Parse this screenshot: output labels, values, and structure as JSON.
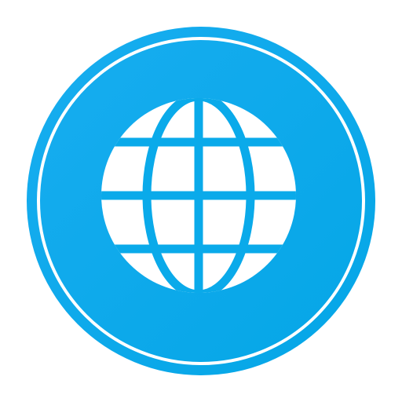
{
  "icon": {
    "name": "globe-icon",
    "badge_color": "#0AAAEA",
    "ring_color": "#FFFFFF",
    "glyph_color": "#FFFFFF"
  }
}
